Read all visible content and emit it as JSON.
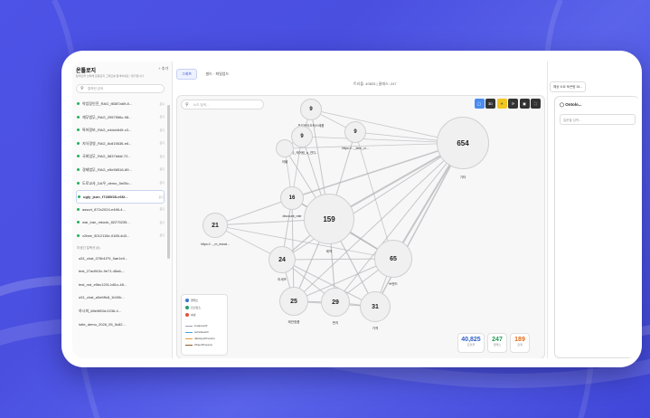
{
  "sidebar": {
    "title": "온톨로지",
    "add_label": "+ 추가",
    "description": "탐색산을 선택해 온톨로지 그래프를 탐색하세요 / 열기합니다",
    "search_placeholder": "컬렉션 검색",
    "items": [
      {
        "name": "약업장인진_RAG_f8387a69-8...",
        "tag": "온디"
      },
      {
        "name": "재무법무_RAG_2957556c-98...",
        "tag": "온디"
      },
      {
        "name": "특허정보_RAG_e4dcb649-c3...",
        "tag": "온디"
      },
      {
        "name": "지식경영_RAG_6c815636-e6...",
        "tag": "온디"
      },
      {
        "name": "국회업무_RAG_5837b6df-72...",
        "tag": "온디"
      },
      {
        "name": "경제법무_RAG_e5e56516-89...",
        "tag": "온디"
      },
      {
        "name": "도로교사_DA우_demo_5e05c...",
        "tag": "온디"
      },
      {
        "name": "ugly_json_f7280f28-e6f2...",
        "tag": "온디",
        "active": true
      },
      {
        "name": "assort_872c2024-e486-4...",
        "tag": "온디"
      },
      {
        "name": "war_iran_mkook_82275235...",
        "tag": "온디"
      },
      {
        "name": "v2bee_5012115e-0185-4d3...",
        "tag": "온디"
      }
    ],
    "section_label": "미생긴 컬렉션 (8)",
    "inactive_items": [
      {
        "name": "u51_chat_076b1f79_9ae1e0..."
      },
      {
        "name": "test_27ad910c-9e71-48a6-..."
      },
      {
        "name": "test_md_e5bc1201-b81c-48..."
      },
      {
        "name": "u51_chat_a0e6ffc8_1b00b..."
      },
      {
        "name": "하시피_68e0f83d-0236-4..."
      },
      {
        "name": "lotte_demo_2026_05_5c82..."
      }
    ]
  },
  "main": {
    "tabs": [
      {
        "label": "그래프",
        "active": true
      },
      {
        "label": "빌드 · 파일업드",
        "active": false
      }
    ],
    "stats_text": "트리플: 40825 | 클래스: 247",
    "node_search_placeholder": "노드 검색...",
    "toolbar": [
      "",
      "3D",
      "☀",
      "⟳",
      "▣",
      "⛶"
    ]
  },
  "graph": {
    "nodes": [
      {
        "id": "n654",
        "count": "654",
        "label": "기타"
      },
      {
        "id": "n159",
        "count": "159",
        "label": "제약"
      },
      {
        "id": "n65",
        "count": "65",
        "label": "브랜드"
      },
      {
        "id": "n31",
        "count": "31",
        "label": "가격"
      },
      {
        "id": "n29",
        "count": "29",
        "label": "판지"
      },
      {
        "id": "n25",
        "count": "25",
        "label": "제안정품"
      },
      {
        "id": "n24",
        "count": "24",
        "label": "리세즈"
      },
      {
        "id": "n21",
        "count": "21",
        "label": "https://..._m_esnat..."
      },
      {
        "id": "n16",
        "count": "16",
        "label": "discount_rate"
      },
      {
        "id": "n9a",
        "count": "9",
        "label": "프로바이오틱스제품"
      },
      {
        "id": "n9b",
        "count": "9",
        "label": "다이라_캐어링_a_연디..."
      },
      {
        "id": "n9c",
        "count": "9",
        "label": "https://..._item_ci..."
      },
      {
        "id": "n5",
        "count": "",
        "label": "어불"
      }
    ]
  },
  "legend": {
    "entries": [
      {
        "label": "클래스",
        "color": "#3b73d9",
        "kind": "dot"
      },
      {
        "label": "인스턴스",
        "color": "#1f9d6a",
        "kind": "dot"
      },
      {
        "label": "속성",
        "color": "#e0523a",
        "kind": "dot"
      },
      {
        "label": "instanceOf",
        "color": "#9aa3b5",
        "kind": "line"
      },
      {
        "label": "subClassOf",
        "color": "#4aa0d8",
        "kind": "line"
      },
      {
        "label": "datatypeProperty",
        "color": "#f09a3a",
        "kind": "line"
      },
      {
        "label": "ObjectProperty",
        "color": "#8a5a2a",
        "kind": "line"
      }
    ]
  },
  "stat_cards": [
    {
      "value": "40,825",
      "label": "트리플",
      "color": "#2f5fc7"
    },
    {
      "value": "247",
      "label": "클래스",
      "color": "#1e9a52"
    },
    {
      "value": "189",
      "label": "관계",
      "color": "#e06a1a"
    }
  ],
  "right_panel": {
    "cost_label": "예상 소요 토큰량 34...",
    "title": "Ontolo...",
    "input_placeholder": "질문을 입력..."
  }
}
